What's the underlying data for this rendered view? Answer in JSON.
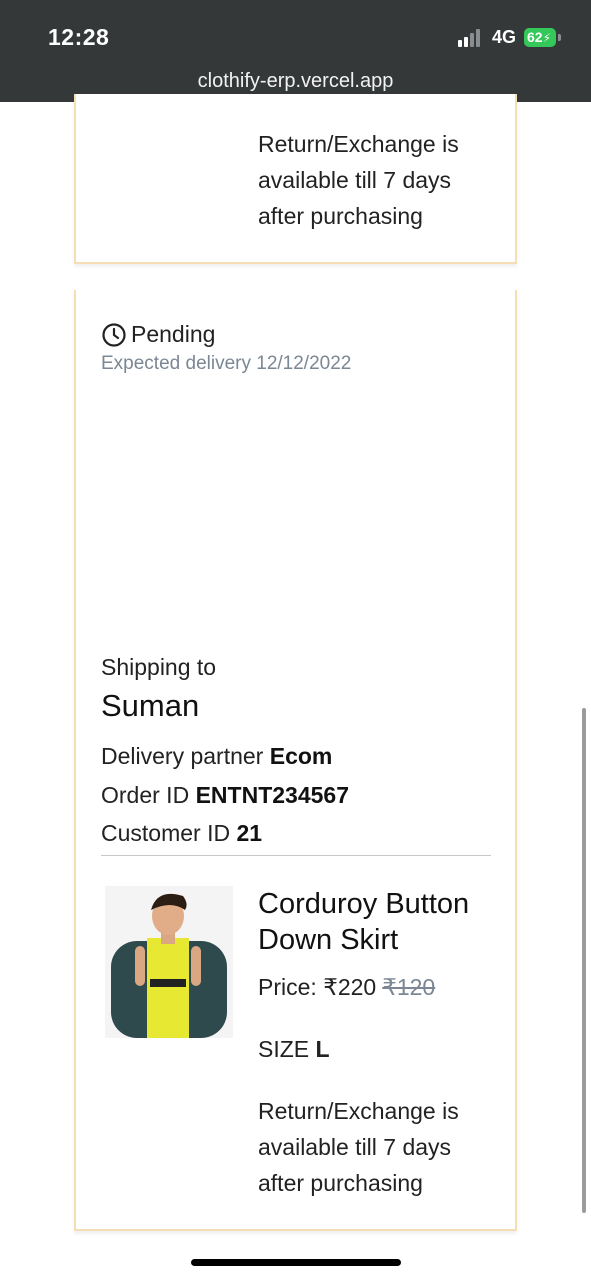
{
  "status_bar": {
    "time": "12:28",
    "network": "4G",
    "battery": "62"
  },
  "browser": {
    "url": "clothify-erp.vercel.app"
  },
  "top_card": {
    "return_policy": "Return/Exchange is available till 7 days after purchasing"
  },
  "order": {
    "status": "Pending",
    "expected_delivery": "Expected delivery 12/12/2022",
    "shipping_label": "Shipping to",
    "shipping_name": "Suman",
    "delivery_partner_label": "Delivery partner",
    "delivery_partner": "Ecom",
    "order_id_label": "Order ID",
    "order_id": "ENTNT234567",
    "customer_id_label": "Customer ID",
    "customer_id": "21",
    "product": {
      "title": "Corduroy Button Down Skirt",
      "price_label": "Price:",
      "price": "₹220",
      "mrp": "₹120",
      "size_label": "SIZE",
      "size": "L",
      "return_policy": "Return/Exchange is available till 7 days after purchasing"
    }
  },
  "colors": {
    "card_border": "#f5deb3",
    "status_bar_bg": "#353839",
    "battery": "#34c759",
    "muted_text": "#7b8794"
  }
}
